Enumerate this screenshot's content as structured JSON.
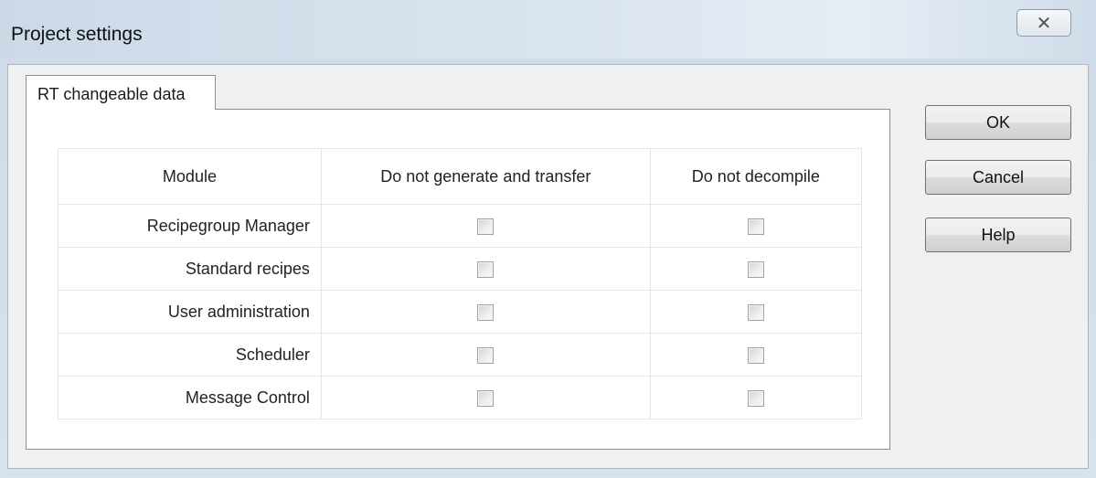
{
  "window": {
    "title": "Project settings",
    "close_glyph": "✕"
  },
  "tab": {
    "label": "RT changeable data"
  },
  "table": {
    "headers": [
      "Module",
      "Do not generate and transfer",
      "Do not decompile"
    ],
    "rows": [
      {
        "module": "Recipegroup Manager",
        "no_generate": false,
        "no_decompile": false
      },
      {
        "module": "Standard recipes",
        "no_generate": false,
        "no_decompile": false
      },
      {
        "module": "User administration",
        "no_generate": false,
        "no_decompile": false
      },
      {
        "module": "Scheduler",
        "no_generate": false,
        "no_decompile": false
      },
      {
        "module": "Message Control",
        "no_generate": false,
        "no_decompile": false
      }
    ]
  },
  "buttons": {
    "ok": "OK",
    "cancel": "Cancel",
    "help": "Help"
  }
}
